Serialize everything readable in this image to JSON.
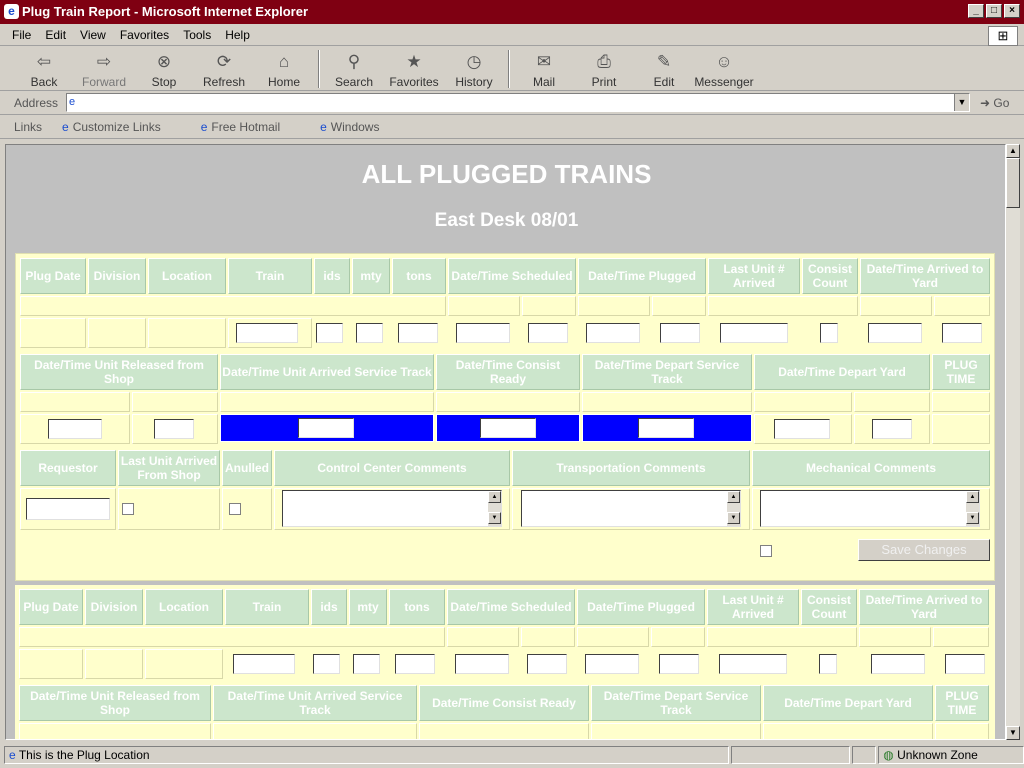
{
  "window": {
    "title": "Plug Train Report - Microsoft Internet Explorer"
  },
  "menu": {
    "items": [
      "File",
      "Edit",
      "View",
      "Favorites",
      "Tools",
      "Help"
    ]
  },
  "toolbar": {
    "buttons": [
      {
        "label": "Back",
        "icon": "back-arrow-icon"
      },
      {
        "label": "Forward",
        "icon": "forward-arrow-icon"
      },
      {
        "label": "Stop",
        "icon": "stop-icon"
      },
      {
        "label": "Refresh",
        "icon": "refresh-icon"
      },
      {
        "label": "Home",
        "icon": "home-icon"
      },
      {
        "label": "Search",
        "icon": "search-icon"
      },
      {
        "label": "Favorites",
        "icon": "favorites-icon"
      },
      {
        "label": "History",
        "icon": "history-icon"
      },
      {
        "label": "Mail",
        "icon": "mail-icon"
      },
      {
        "label": "Print",
        "icon": "print-icon"
      },
      {
        "label": "Edit",
        "icon": "edit-icon"
      },
      {
        "label": "Messenger",
        "icon": "messenger-icon"
      }
    ]
  },
  "address": {
    "label": "Address",
    "value": "",
    "go": "Go"
  },
  "links": {
    "label": "Links",
    "items": [
      "Customize Links",
      "Free Hotmail",
      "Windows"
    ]
  },
  "page": {
    "title": "ALL PLUGGED TRAINS",
    "subtitle": "East Desk 08/01"
  },
  "record": {
    "row1_headers": [
      "Plug Date",
      "Division",
      "Location",
      "Train",
      "ids",
      "mty",
      "tons",
      "Date/Time Scheduled",
      "Date/Time Plugged",
      "Last Unit # Arrived",
      "Consist Count",
      "Date/Time Arrived to Yard"
    ],
    "row2_headers": [
      "Date/Time Unit Released from Shop",
      "Date/Time Unit Arrived Service Track",
      "Date/Time Consist Ready",
      "Date/Time Depart Service Track",
      "Date/Time Depart Yard",
      "PLUG TIME"
    ],
    "row3_headers": [
      "Requestor",
      "Last Unit Arrived From Shop",
      "Anulled",
      "Control Center Comments",
      "Transportation Comments",
      "Mechanical Comments"
    ],
    "save_label": "Save Changes"
  },
  "status": {
    "text": "This is the Plug Location",
    "zone": "Unknown Zone"
  }
}
